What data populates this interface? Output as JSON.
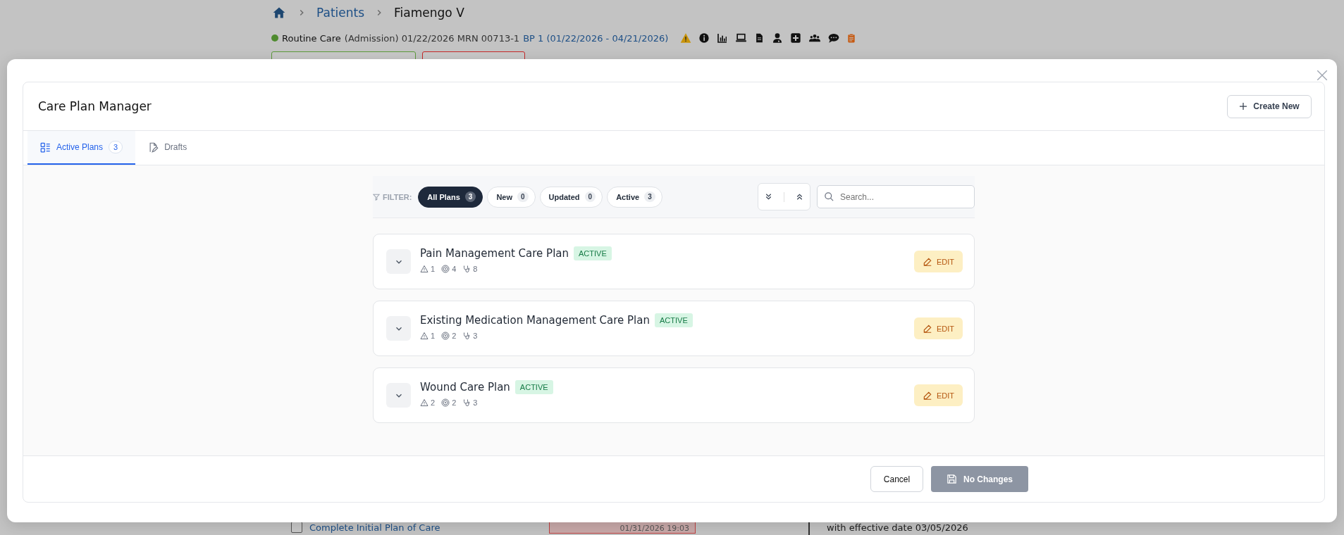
{
  "background": {
    "breadcrumbs": [
      "Patients",
      "Fiamengo V"
    ],
    "encounter": {
      "care_type": "Routine Care",
      "detail": "(Admission) 01/22/2026 MRN 00713-1",
      "bp_link": "BP 1 (01/22/2026 - 04/21/2026)"
    },
    "tags": [
      {
        "kind": "diagnosis"
      },
      {
        "kind": "allergy"
      }
    ],
    "task": {
      "label": "Complete Initial Plan of Care",
      "checked": false
    },
    "timestamp": "01/31/2026 19:03",
    "note": "with effective date 03/05/2026"
  },
  "modal": {
    "title": "Care Plan Manager",
    "create_button": "Create New",
    "tabs": [
      {
        "label": "Active Plans",
        "count": "3",
        "selected": true
      },
      {
        "label": "Drafts",
        "selected": false
      }
    ],
    "filter": {
      "label": "FILTER:",
      "chips": [
        {
          "label": "All Plans",
          "count": "3",
          "selected": true
        },
        {
          "label": "New",
          "count": "0",
          "selected": false
        },
        {
          "label": "Updated",
          "count": "0",
          "selected": false
        },
        {
          "label": "Active",
          "count": "3",
          "selected": false
        }
      ]
    },
    "search": {
      "placeholder": "Search..."
    },
    "plans": [
      {
        "title": "Pain Management Care Plan",
        "status": "ACTIVE",
        "problems": "1",
        "goals": "4",
        "interventions": "8",
        "edit": "EDIT",
        "expanded": false
      },
      {
        "title": "Existing Medication Management Care Plan",
        "status": "ACTIVE",
        "problems": "1",
        "goals": "2",
        "interventions": "3",
        "edit": "EDIT",
        "expanded": false
      },
      {
        "title": "Wound Care Plan",
        "status": "ACTIVE",
        "problems": "2",
        "goals": "2",
        "interventions": "3",
        "edit": "EDIT",
        "expanded": false
      }
    ],
    "footer": {
      "cancel": "Cancel",
      "save": {
        "label": "No Changes",
        "disabled": true
      }
    }
  }
}
